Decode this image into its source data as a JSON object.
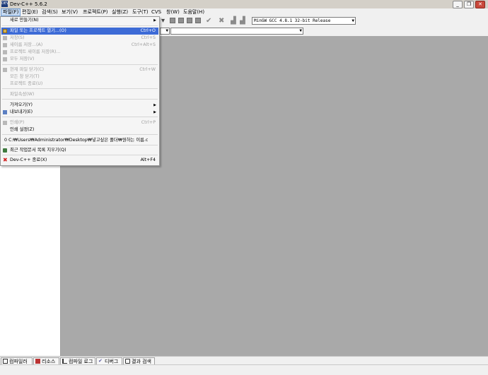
{
  "window": {
    "icon_text": "DEV",
    "title": "Dev-C++ 5.6.2",
    "minimize": "_",
    "restore": "❐",
    "close": "✕"
  },
  "menubar": [
    {
      "label": "파일(F)"
    },
    {
      "label": "편집(E)"
    },
    {
      "label": "검색(S)"
    },
    {
      "label": "보기(V)"
    },
    {
      "label": "프로젝트(P)"
    },
    {
      "label": "실행(Z)"
    },
    {
      "label": "도구(T)"
    },
    {
      "label": "CVS"
    },
    {
      "label": "창(W)"
    },
    {
      "label": "도움말(H)"
    }
  ],
  "toolbar": {
    "compiler_select": "MinGW GCC 4.8.1 32-bit Release"
  },
  "file_menu": {
    "items": [
      {
        "label": "새로 만들기(N)",
        "submenu": "▶"
      },
      {
        "label": "파일 또는 프로젝트 열기...(O)",
        "shortcut": "Ctrl+O",
        "icon": "open-folder-icon"
      },
      {
        "label": "저장(S)",
        "shortcut": "Ctrl+S",
        "icon": "save-icon"
      },
      {
        "label": "새이름 저장...(A)",
        "icon": "save-as-icon"
      },
      {
        "label": "프로젝트 새이름 저장(R)..."
      },
      {
        "label": "모두 저장(V)",
        "shortcut": "Ctrl+Alt+S",
        "icon": "save-all-icon"
      },
      {
        "label": "현재 파일 닫기(C)",
        "shortcut": "Ctrl+W",
        "icon": "close-file-icon"
      },
      {
        "label": "모든 창 닫기(T)"
      },
      {
        "label": "프로젝트 종료(U)"
      },
      {
        "label": "파일속성(W)"
      },
      {
        "label": "가져오기(Y)",
        "submenu": "▶"
      },
      {
        "label": "내보내기(E)",
        "submenu": "▶",
        "icon": "export-icon"
      },
      {
        "label": "인쇄(P)",
        "shortcut": "Ctrl+P",
        "icon": "print-icon"
      },
      {
        "label": "인쇄 설정(Z)"
      },
      {
        "label": "0 C:₩Users₩Administrator₩Desktop₩넣고싶은 폴더₩원하는 이름.c"
      },
      {
        "label": "최근 작업문서 목록 지우기(Q)",
        "icon": "trash-icon"
      },
      {
        "label": "Dev-C++ 종료(X)",
        "shortcut": "Alt+F4",
        "icon": "exit-icon"
      }
    ]
  },
  "bottom_tabs": [
    {
      "label": "컴파일러",
      "icon": "grid-icon"
    },
    {
      "label": "리소스",
      "icon": "resource-icon"
    },
    {
      "label": "컴파일 로그",
      "icon": "chart-icon"
    },
    {
      "label": "디버그",
      "icon": "check-icon"
    },
    {
      "label": "결과 검색",
      "icon": "find-icon"
    }
  ],
  "colors": {
    "highlight": "#3d6bd6",
    "editor_bg": "#a9a9a9",
    "chrome": "#f0f0f0"
  }
}
